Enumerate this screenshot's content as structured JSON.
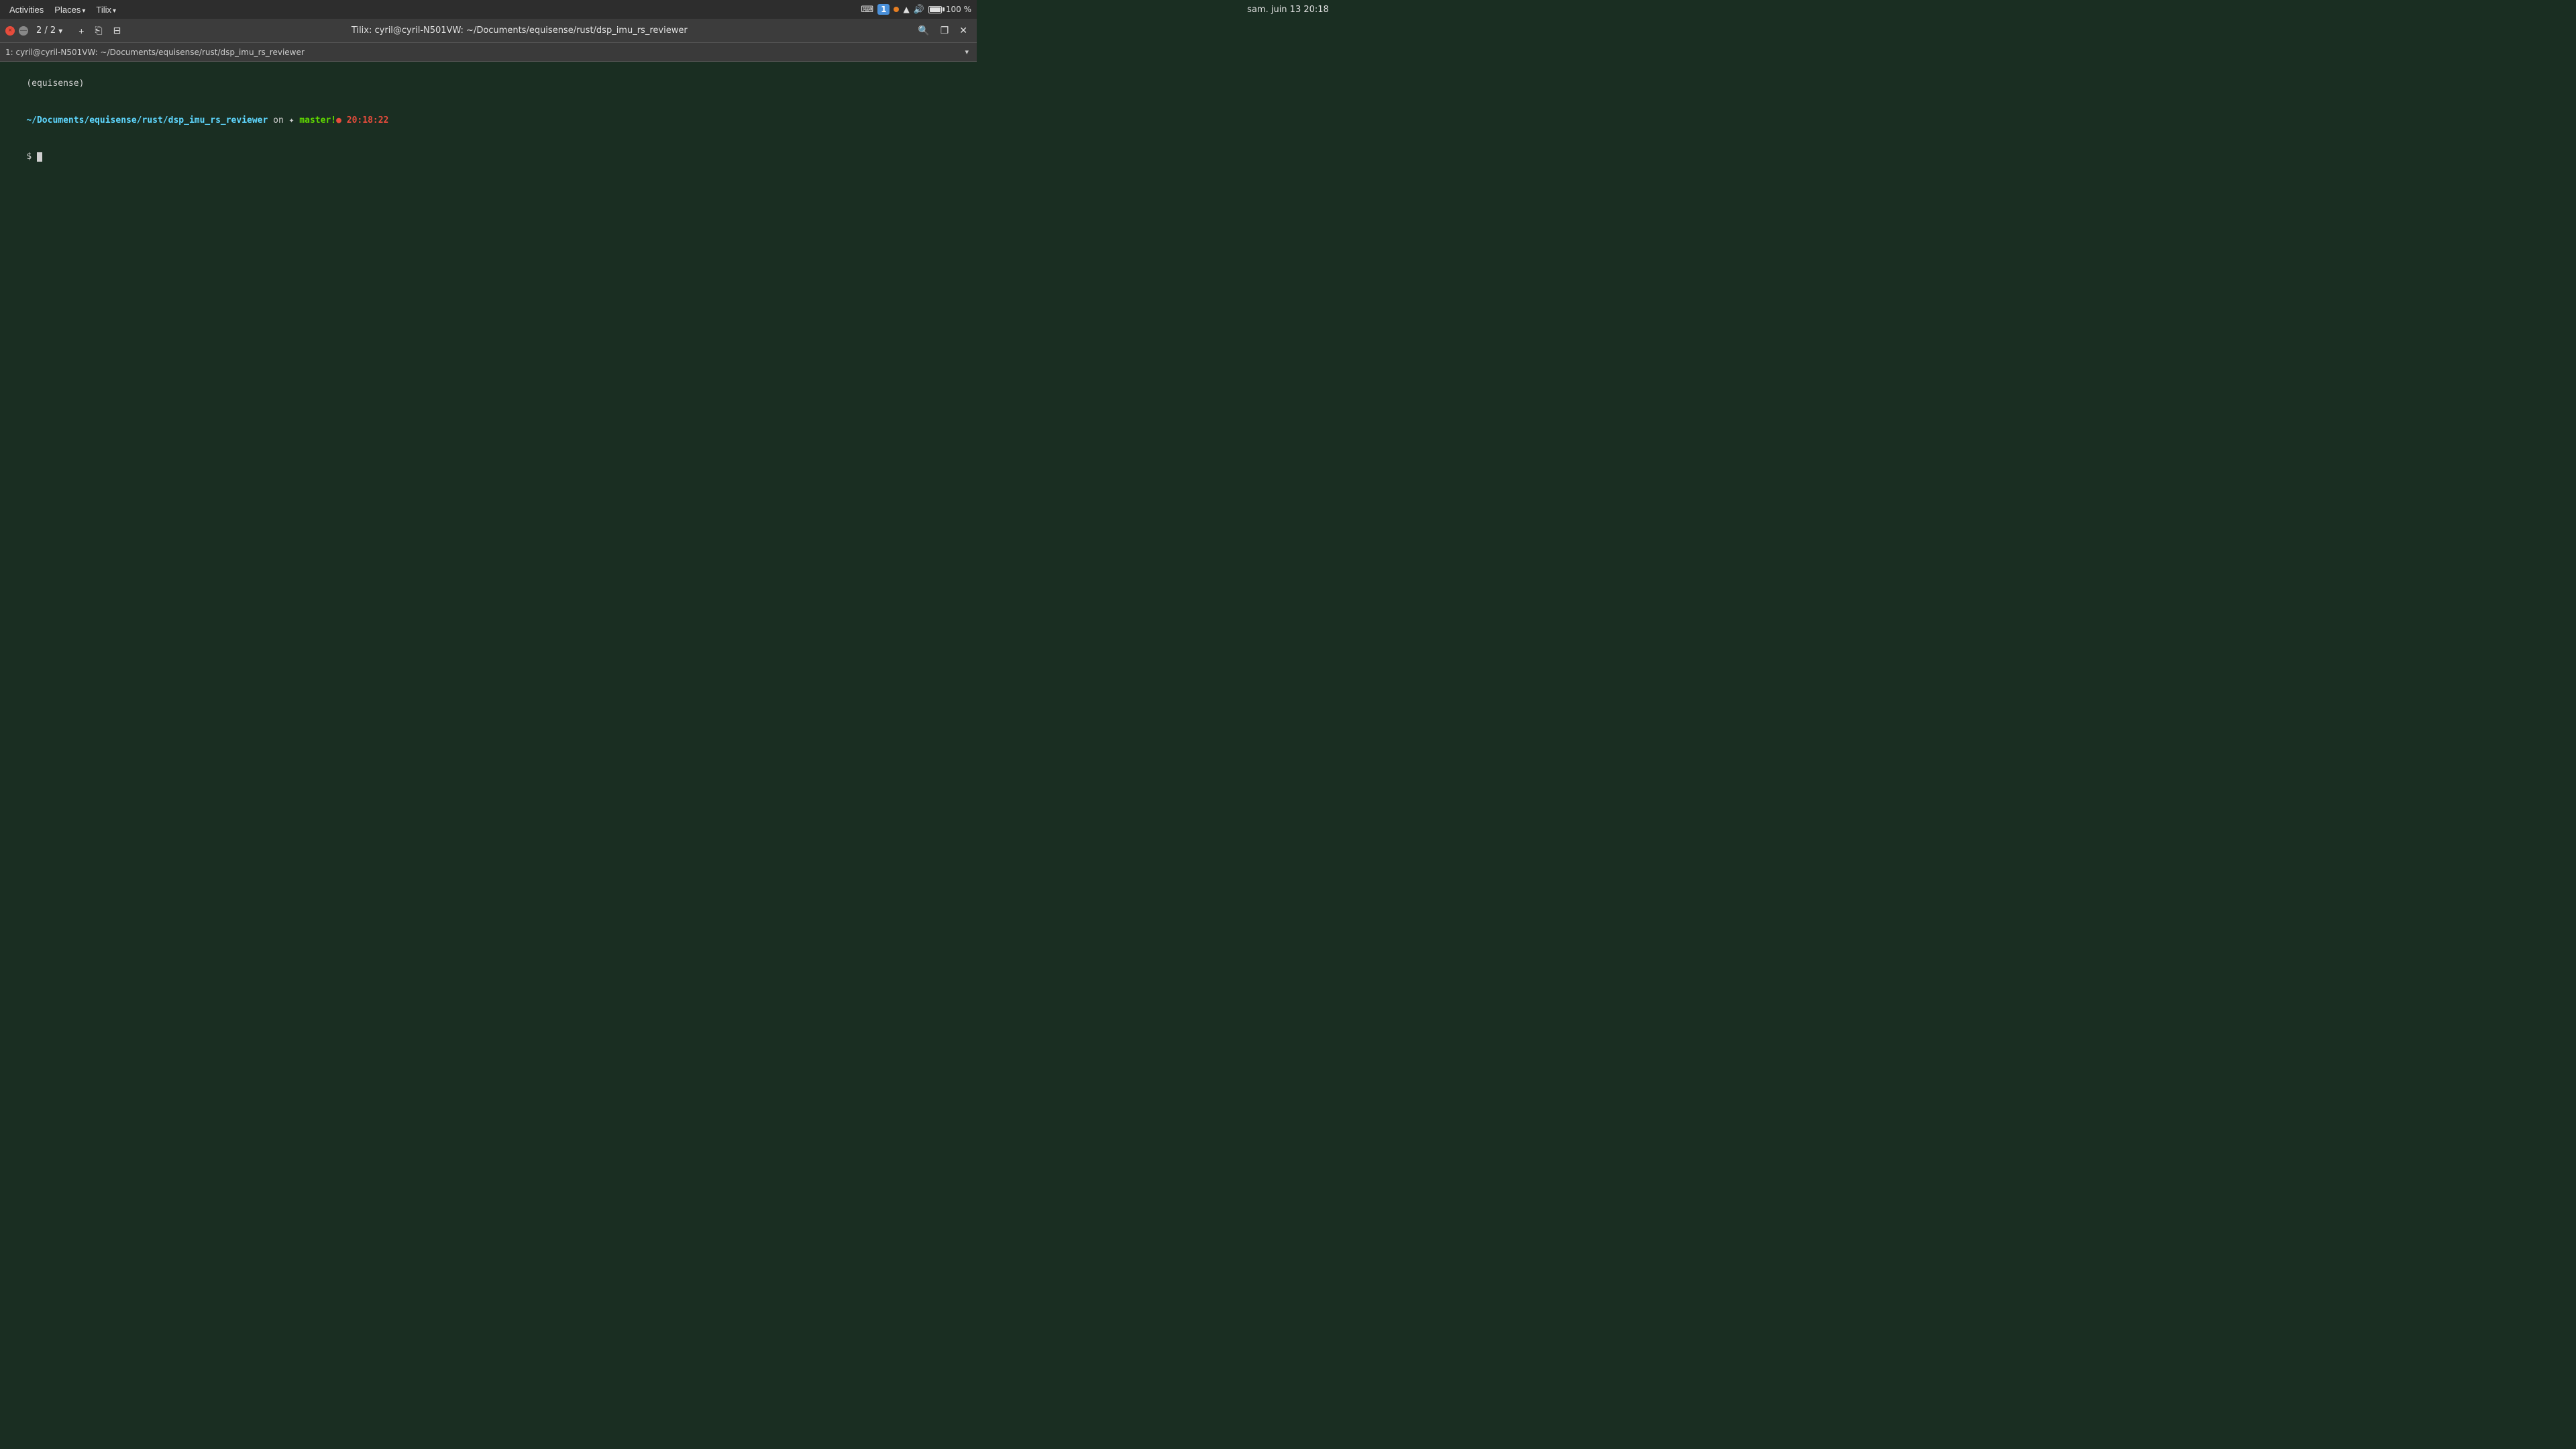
{
  "system_bar": {
    "left": {
      "activities": "Activities",
      "places": "Places",
      "places_arrow": "▾",
      "tilix": "Tilix",
      "tilix_arrow": "▾"
    },
    "center": {
      "datetime": "sam. juin 13  20:18"
    },
    "right": {
      "keyboard_icon": "⌨",
      "num_badge": "1",
      "battery_percent": "100 %",
      "volume_icon": "🔊",
      "wifi_icon": "▲",
      "network_dot": "●"
    }
  },
  "title_bar": {
    "close_label": "×",
    "minimize_label": "—",
    "tab_counter": "2 / 2",
    "add_tab": "+",
    "detach_tab": "⎋",
    "split_h": "⊞",
    "title": "Tilix: cyril@cyril-N501VW: ~/Documents/equisense/rust/dsp_imu_rs_reviewer",
    "search_icon": "🔍",
    "restore_icon": "❐",
    "close_win_icon": "✕"
  },
  "path_bar": {
    "path_text": "1: cyril@cyril-N501VW: ~/Documents/equisense/rust/dsp_imu_rs_reviewer",
    "dropdown_arrow": "▾"
  },
  "terminal": {
    "env": "(equisense)",
    "path": "~/Documents/equisense/rust/dsp_imu_rs_reviewer",
    "on_text": " on ",
    "branch_icon": "✦",
    "branch_name": " master!",
    "dot": "●",
    "time": " 20:18:22",
    "prompt": "$ "
  }
}
